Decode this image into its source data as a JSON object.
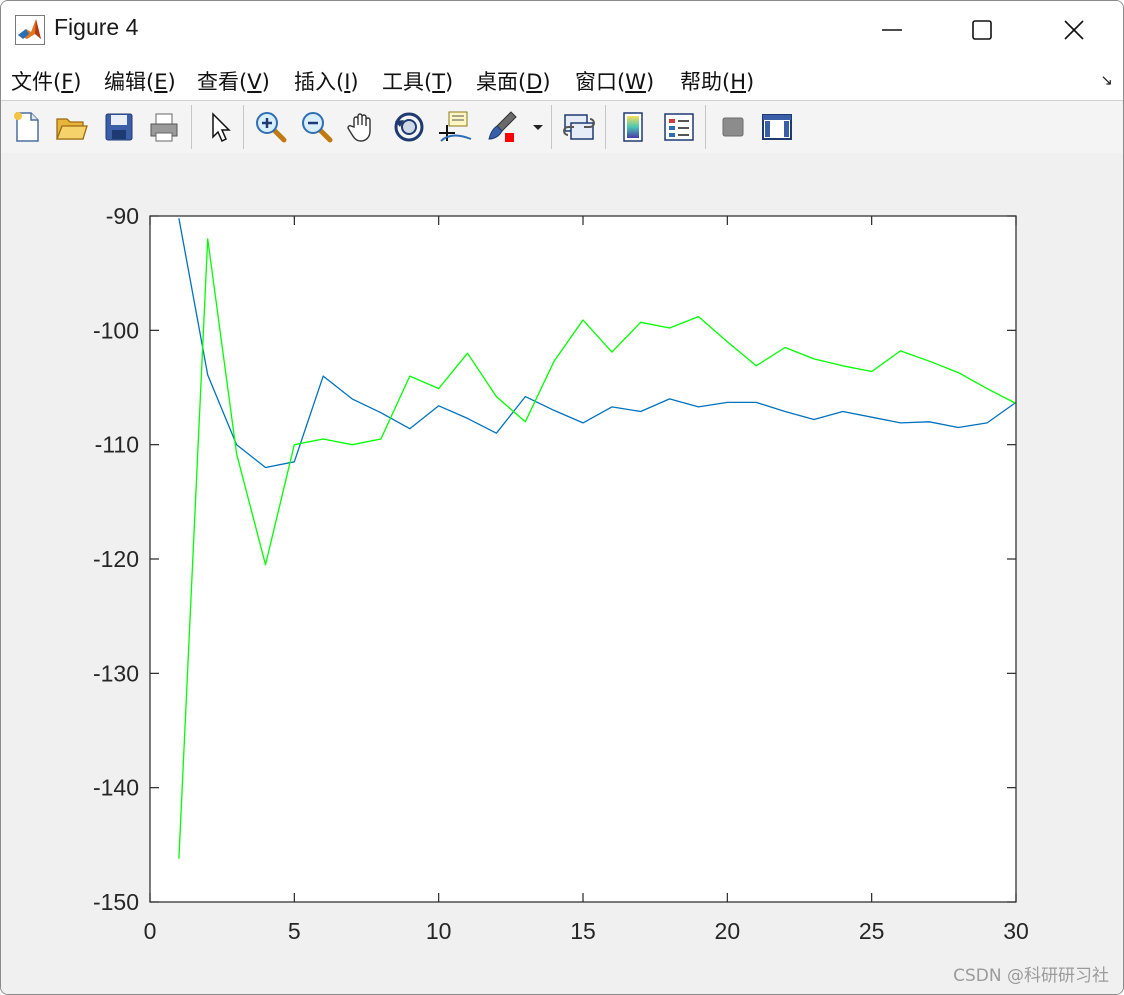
{
  "window": {
    "title": "Figure 4"
  },
  "menu": [
    {
      "label": "文件(",
      "key": "F",
      "end": ")"
    },
    {
      "label": "编辑(",
      "key": "E",
      "end": ")"
    },
    {
      "label": "查看(",
      "key": "V",
      "end": ")"
    },
    {
      "label": "插入(",
      "key": "I",
      "end": ")"
    },
    {
      "label": "工具(",
      "key": "T",
      "end": ")"
    },
    {
      "label": "桌面(",
      "key": "D",
      "end": ")"
    },
    {
      "label": "窗口(",
      "key": "W",
      "end": ")"
    },
    {
      "label": "帮助(",
      "key": "H",
      "end": ")"
    }
  ],
  "menu_arrow": "↘",
  "toolbar_icons": [
    "new-figure-icon",
    "open-file-icon",
    "save-icon",
    "print-icon",
    "edit-plot-arrow-icon",
    "zoom-in-icon",
    "zoom-out-icon",
    "pan-hand-icon",
    "rotate-3d-icon",
    "data-cursor-icon",
    "brush-icon",
    "brush-dropdown-icon",
    "link-plot-icon",
    "colorbar-icon",
    "legend-icon",
    "hide-plot-tools-icon",
    "show-plot-tools-icon"
  ],
  "watermark": "CSDN @科研研习社",
  "colors": {
    "series_blue": "#0072BD",
    "series_green": "#00FF00"
  },
  "chart_data": {
    "type": "line",
    "x": [
      1,
      2,
      3,
      4,
      5,
      6,
      7,
      8,
      9,
      10,
      11,
      12,
      13,
      14,
      15,
      16,
      17,
      18,
      19,
      20,
      21,
      22,
      23,
      24,
      25,
      26,
      27,
      28,
      29,
      30
    ],
    "xlim": [
      0,
      30
    ],
    "ylim": [
      -150,
      -90
    ],
    "xticks": [
      0,
      5,
      10,
      15,
      20,
      25,
      30
    ],
    "yticks": [
      -90,
      -100,
      -110,
      -120,
      -130,
      -140,
      -150
    ],
    "xtick_labels": [
      "0",
      "5",
      "10",
      "15",
      "20",
      "25",
      "30"
    ],
    "ytick_labels": [
      "-90",
      "-100",
      "-110",
      "-120",
      "-130",
      "-140",
      "-150"
    ],
    "grid": false,
    "series": [
      {
        "color": "#0072BD",
        "values": [
          -90.2,
          -103.9,
          -110.0,
          -112.0,
          -111.5,
          -104.0,
          -106.0,
          -107.2,
          -108.6,
          -106.6,
          -107.7,
          -109.0,
          -105.8,
          -107.0,
          -108.1,
          -106.7,
          -107.1,
          -106.0,
          -106.7,
          -106.3,
          -106.3,
          -107.1,
          -107.8,
          -107.1,
          -107.6,
          -108.1,
          -108.0,
          -108.5,
          -108.1,
          -106.3
        ]
      },
      {
        "color": "#00FF00",
        "values": [
          -146.2,
          -92.0,
          -110.8,
          -120.5,
          -110.0,
          -109.5,
          -110.0,
          -109.5,
          -104.0,
          -105.1,
          -102.0,
          -105.8,
          -108.0,
          -102.7,
          -99.1,
          -101.9,
          -99.3,
          -99.8,
          -98.8,
          -101.0,
          -103.1,
          -101.5,
          -102.5,
          -103.1,
          -103.6,
          -101.8,
          -102.7,
          -103.7,
          -105.1,
          -106.4
        ]
      }
    ]
  }
}
